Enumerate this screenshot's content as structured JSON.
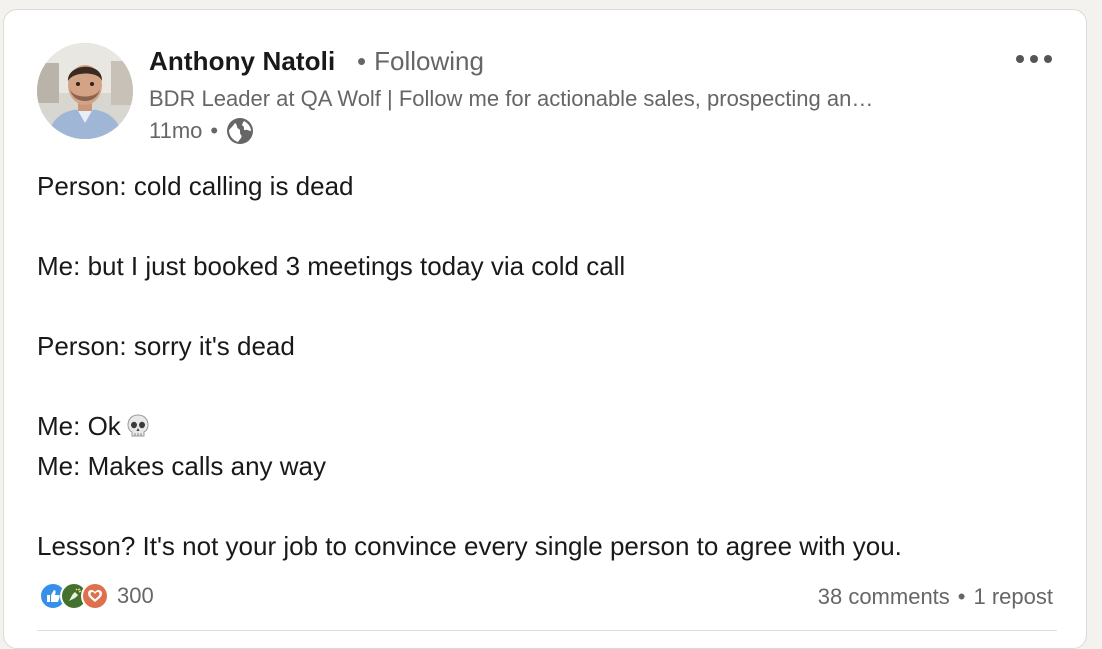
{
  "author": {
    "name": "Anthony Natoli",
    "follow_status": "Following",
    "headline": "BDR Leader at QA Wolf | Follow me for actionable sales, prospecting an…",
    "time_ago": "11mo",
    "visibility_icon": "globe-icon"
  },
  "post": {
    "lines": [
      "Person: cold calling is dead",
      "",
      "Me: but I just booked 3 meetings today via cold call",
      "",
      "Person: sorry it's dead",
      "",
      "Me: Ok",
      "Me: Makes calls any way",
      "",
      "Lesson? It's not your job to convince every single person to agree with you."
    ],
    "emoji_after_line_7": "skull-emoji"
  },
  "footer": {
    "reaction_icons": [
      "like-icon",
      "celebrate-icon",
      "love-icon"
    ],
    "reaction_count": "300",
    "comments": "38 comments",
    "reposts": "1 repost"
  },
  "colors": {
    "like": "#378fe9",
    "celebrate": "#44712e",
    "love": "#df704d",
    "muted_text": "#666666"
  }
}
